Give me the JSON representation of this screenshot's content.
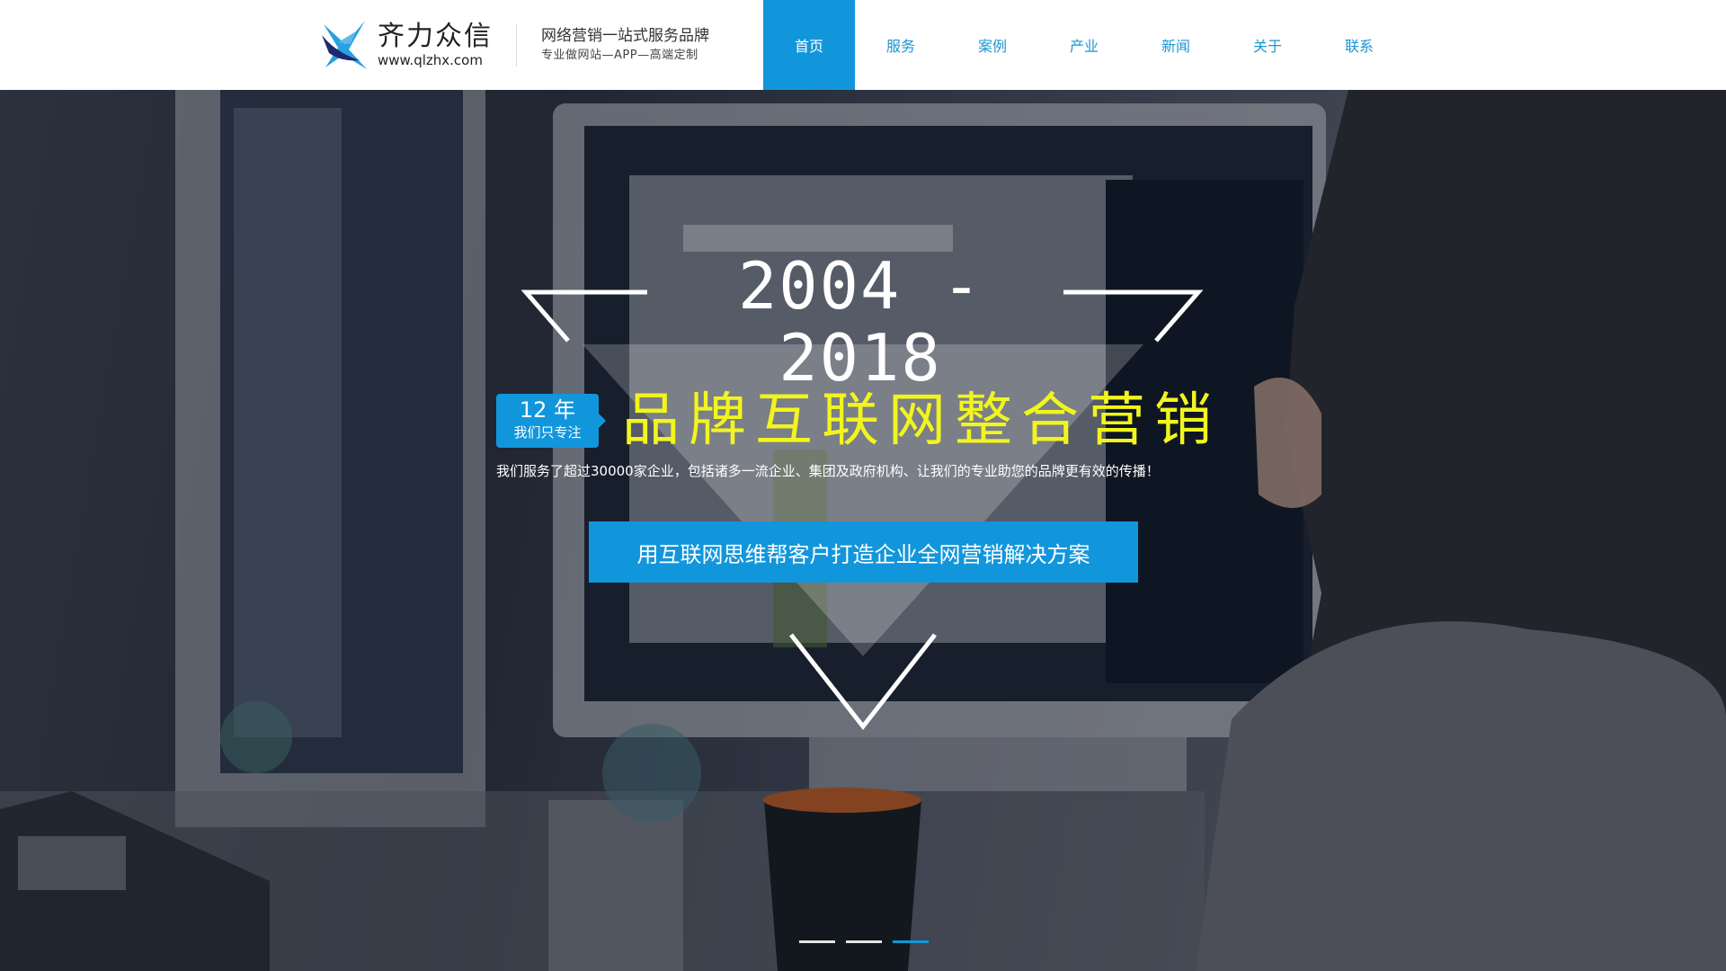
{
  "header": {
    "logo": {
      "name": "齐力众信",
      "domain": "www.qlzhx.com"
    },
    "slogan": {
      "main": "网络营销一站式服务品牌",
      "sub": "专业做网站—APP—高端定制"
    }
  },
  "nav": {
    "items": [
      {
        "label": "首页",
        "active": true
      },
      {
        "label": "服务"
      },
      {
        "label": "案例"
      },
      {
        "label": "产业"
      },
      {
        "label": "新闻"
      },
      {
        "label": "关于"
      },
      {
        "label": "联系"
      }
    ]
  },
  "hero": {
    "years": "2004 - 2018",
    "badge": {
      "years": "12 年",
      "focus": "我们只专注"
    },
    "headline": "品牌互联网整合营销",
    "description": "我们服务了超过30000家企业，包括诸多一流企业、集团及政府机构、让我们的专业助您的品牌更有效的传播！",
    "cta": "用互联网思维帮客户打造企业全网营销解决方案",
    "slides": {
      "count": 3,
      "active": 3
    }
  },
  "colors": {
    "brand_blue": "#1296db",
    "headline_yellow": "#f2f51d"
  }
}
